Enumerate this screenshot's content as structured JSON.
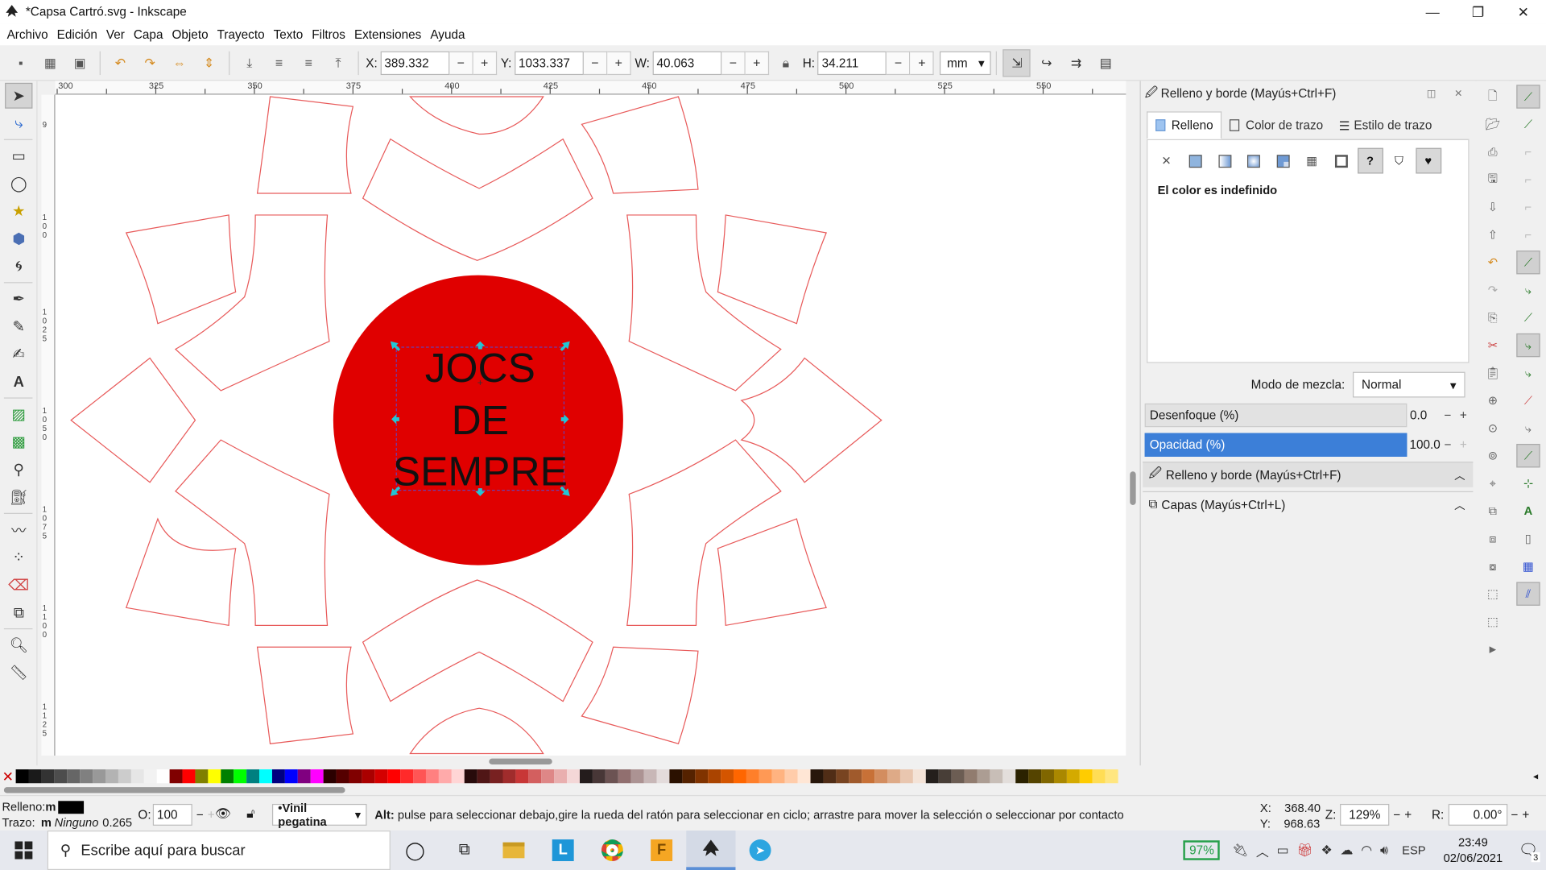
{
  "window": {
    "title": "*Capsa Cartró.svg - Inkscape",
    "controls": [
      "—",
      "❐",
      "✕"
    ]
  },
  "menu": [
    "Archivo",
    "Edición",
    "Ver",
    "Capa",
    "Objeto",
    "Trayecto",
    "Texto",
    "Filtros",
    "Extensiones",
    "Ayuda"
  ],
  "toolbar": {
    "x": {
      "label": "X:",
      "value": "389.332"
    },
    "y": {
      "label": "Y:",
      "value": "1033.337"
    },
    "w": {
      "label": "W:",
      "value": "40.063"
    },
    "h": {
      "label": "H:",
      "value": "34.211"
    },
    "unit": "mm"
  },
  "ruler_top_labels": [
    "300",
    "325",
    "350",
    "375",
    "400",
    "425",
    "450",
    "475",
    "500",
    "525",
    "550"
  ],
  "ruler_left_labels": [
    "9",
    "1 0 0",
    "1 0 2 5",
    "1 0 5 0",
    "1 0 7 5",
    "1 1 0 0",
    "1 1 2 5"
  ],
  "canvas": {
    "text_lines": [
      "JOCS",
      "DE",
      "SEMPRE"
    ],
    "circle_color": "#e00000",
    "outline_color": "#e85a5a"
  },
  "fill_stroke": {
    "panel_title": "Relleno y borde (Mayús+Ctrl+F)",
    "tabs": [
      {
        "label": "Relleno",
        "active": true
      },
      {
        "label": "Color de trazo",
        "active": false
      },
      {
        "label": "Estilo de trazo",
        "active": false
      }
    ],
    "fill_modes": [
      "✕",
      "flat",
      "linear",
      "radial",
      "mesh",
      "pattern",
      "swatch",
      "?",
      "unset",
      "heart"
    ],
    "status_text": "El color es indefinido",
    "blend_label": "Modo de mezcla:",
    "blend_value": "Normal",
    "blur": {
      "label": "Desenfoque (%)",
      "value": "0.0",
      "level": 0
    },
    "opacity": {
      "label": "Opacidad (%)",
      "value": "100.0",
      "level": 100
    },
    "collapsed": [
      {
        "label": "Relleno y borde (Mayús+Ctrl+F)"
      },
      {
        "label": "Capas (Mayús+Ctrl+L)"
      }
    ]
  },
  "palette": {
    "colors": [
      "#000000",
      "#1a1a1a",
      "#333333",
      "#4d4d4d",
      "#666666",
      "#808080",
      "#999999",
      "#b3b3b3",
      "#cccccc",
      "#e6e6e6",
      "#f2f2f2",
      "#ffffff",
      "#800000",
      "#ff0000",
      "#808000",
      "#ffff00",
      "#008000",
      "#00ff00",
      "#008080",
      "#00ffff",
      "#000080",
      "#0000ff",
      "#800080",
      "#ff00ff",
      "#2b0000",
      "#550000",
      "#800000",
      "#aa0000",
      "#d40000",
      "#ff0000",
      "#ff2a2a",
      "#ff5555",
      "#ff8080",
      "#ffaaaa",
      "#ffd5d5",
      "#280b0b",
      "#501616",
      "#782121",
      "#a02c2c",
      "#c83737",
      "#d35f5f",
      "#de8787",
      "#e9afaf",
      "#f4d7d7",
      "#241c1c",
      "#483737",
      "#6c5353",
      "#916f6f",
      "#ac9393",
      "#c8b7b7",
      "#e3dbdb",
      "#2b1100",
      "#552200",
      "#803300",
      "#aa4400",
      "#d45500",
      "#ff6600",
      "#ff7f2a",
      "#ff9955",
      "#ffb380",
      "#ffccaa",
      "#ffe6d5",
      "#28170b",
      "#502d16",
      "#784421",
      "#a05a2c",
      "#c87137",
      "#d38d5f",
      "#deaa87",
      "#e9c6af",
      "#f4e3d7",
      "#241f1c",
      "#483e37",
      "#6c5d53",
      "#917c6f",
      "#ac9d93",
      "#c8beb7",
      "#e3dedb",
      "#2b2200",
      "#554400",
      "#806600",
      "#aa8800",
      "#d4aa00",
      "#ffcc00",
      "#ffdd55",
      "#ffe680"
    ]
  },
  "status": {
    "fill_label": "Relleno:",
    "fill_value": "m",
    "stroke_label": "Trazo:",
    "stroke_value": "m",
    "stroke_style": "Ninguno",
    "stroke_width": "0.265",
    "opacity_label": "O:",
    "opacity_value": "100",
    "layer": "•Vinil pegatina",
    "hint_bold": "Alt:",
    "hint": "pulse para seleccionar debajo,gire la rueda del ratón para seleccionar en ciclo; arrastre para mover la selección o seleccionar por contacto",
    "cursor_x": "368.40",
    "cursor_y": "968.63",
    "cursor_x_label": "X:",
    "cursor_y_label": "Y:",
    "zoom_label": "Z:",
    "zoom": "129%",
    "rot_label": "R:",
    "rotation": "0.00°"
  },
  "taskbar": {
    "search_placeholder": "Escribe aquí para buscar",
    "battery": "97%",
    "lang": "ESP",
    "time": "23:49",
    "date": "02/06/2021",
    "notifications": "3"
  }
}
